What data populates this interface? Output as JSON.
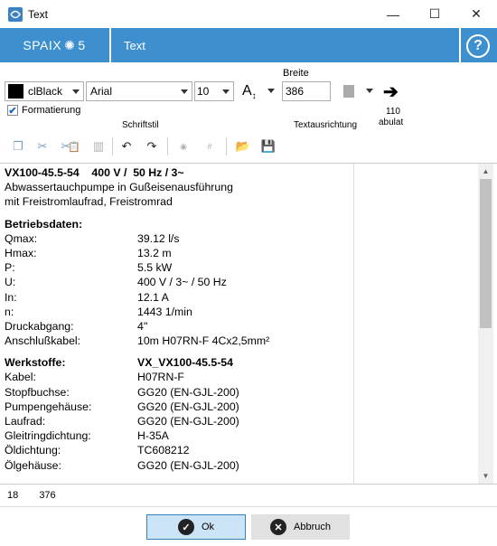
{
  "window": {
    "title": "Text",
    "minimize": "—",
    "maximize": "☐",
    "close": "✕"
  },
  "header": {
    "brand_left": "SPAIX",
    "brand_right": "5",
    "title": "Text",
    "help": "?"
  },
  "toolbar": {
    "color_value": "clBlack",
    "font_value": "Arial",
    "size_value": "10",
    "width_label": "Breite",
    "width_value": "386",
    "tab_value": "110",
    "tab_label": "abulat",
    "format_label": "Formatierung",
    "format_checked": true,
    "group_font_style": "Schriftstil",
    "group_alignment": "Textausrichtung"
  },
  "content": {
    "heading": "VX100-45.5-54    400 V /  50 Hz / 3~",
    "desc1": "Abwassertauchpumpe in Gußeisenausführung",
    "desc2": "mit Freistromlaufrad, Freistromrad",
    "section1": "Betriebsdaten:",
    "operating": [
      {
        "label": "Qmax:",
        "value": "39.12 l/s"
      },
      {
        "label": "Hmax:",
        "value": "13.2 m"
      },
      {
        "label": "P:",
        "value": "5.5 kW"
      },
      {
        "label": "U:",
        "value": "400 V / 3~ / 50 Hz"
      },
      {
        "label": "In:",
        "value": "12.1 A"
      },
      {
        "label": "n:",
        "value": "1443 1/min"
      },
      {
        "label": "Druckabgang:",
        "value": "4''"
      },
      {
        "label": "Anschlußkabel:",
        "value": "10m H07RN-F 4Cx2,5mm²"
      }
    ],
    "section2": "Werkstoffe:",
    "section2_value": "VX_VX100-45.5-54",
    "materials": [
      {
        "label": "Kabel:",
        "value": "H07RN-F"
      },
      {
        "label": "Stopfbuchse:",
        "value": "GG20 (EN-GJL-200)"
      },
      {
        "label": "Pumpengehäuse:",
        "value": "GG20 (EN-GJL-200)"
      },
      {
        "label": "Laufrad:",
        "value": "GG20 (EN-GJL-200)"
      },
      {
        "label": "Gleitringdichtung:",
        "value": "H-35A"
      },
      {
        "label": "Öldichtung:",
        "value": "TC608212"
      },
      {
        "label": "Ölgehäuse:",
        "value": "GG20 (EN-GJL-200)"
      }
    ]
  },
  "status": {
    "line": "18",
    "column": "376"
  },
  "buttons": {
    "ok": "Ok",
    "cancel": "Abbruch"
  },
  "colors": {
    "header_blue": "#3e8fce",
    "ok_bg": "#cce4f7"
  }
}
